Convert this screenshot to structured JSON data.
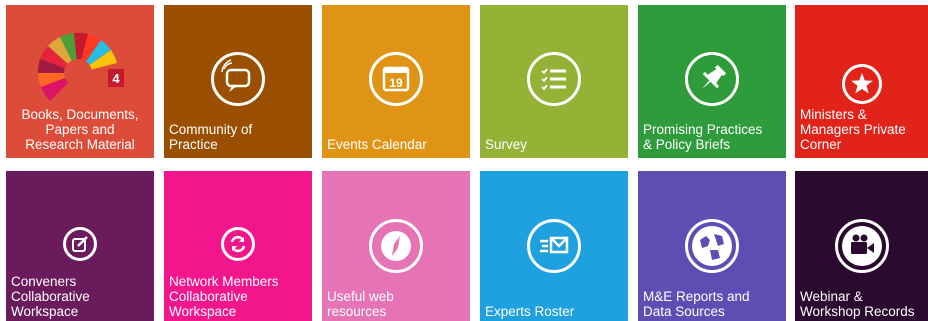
{
  "tiles": [
    {
      "label": "Books, Documents,\nPapers and\nResearch Material",
      "color": "#dd4b39",
      "icon": "sdg-wheel-icon"
    },
    {
      "label": "Community of\nPractice",
      "color": "#9b4f00",
      "icon": "chat-bubble-icon"
    },
    {
      "label": "Events Calendar",
      "color": "#e09416",
      "icon": "calendar-icon",
      "calendar_day": "19"
    },
    {
      "label": "Survey",
      "color": "#93b236",
      "icon": "checklist-icon"
    },
    {
      "label": "Promising Practices\n& Policy Briefs",
      "color": "#2f9c3b",
      "icon": "pushpin-icon"
    },
    {
      "label": "Ministers &\nManagers Private\nCorner",
      "color": "#e2231a",
      "icon": "star-icon"
    },
    {
      "label": "Conveners\nCollaborative\nWorkspace",
      "color": "#6b1a5c",
      "icon": "edit-icon"
    },
    {
      "label": "Network Members\nCollaborative\nWorkspace",
      "color": "#f2158c",
      "icon": "refresh-icon"
    },
    {
      "label": "Useful web\nresources",
      "color": "#e573b6",
      "icon": "compass-icon"
    },
    {
      "label": "Experts Roster",
      "color": "#1fa0df",
      "icon": "mail-send-icon"
    },
    {
      "label": "M&E Reports and\nData Sources",
      "color": "#5e4eb3",
      "icon": "globe-icon"
    },
    {
      "label": "Webinar &\nWorkshop Records",
      "color": "#2a0a2f",
      "icon": "video-camera-icon"
    }
  ],
  "sdg_badge": "4"
}
